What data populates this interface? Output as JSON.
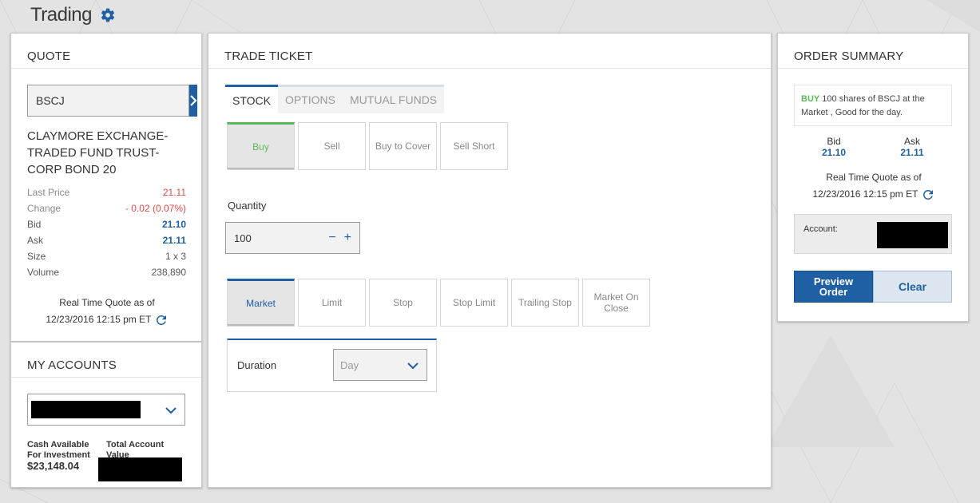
{
  "header": {
    "title": "Trading"
  },
  "quote": {
    "title": "QUOTE",
    "symbol_value": "BSCJ",
    "company": "CLAYMORE EXCHANGE-TRADED FUND TRUST-CORP BOND 20",
    "rows": [
      {
        "label": "Last Price",
        "value": "21.11"
      },
      {
        "label": "Change",
        "value": "- 0.02 (0.07%)"
      },
      {
        "label": "Bid",
        "value": "21.10"
      },
      {
        "label": "Ask",
        "value": "21.11"
      },
      {
        "label": "Size",
        "value": "1 x 3"
      },
      {
        "label": "Volume",
        "value": "238,890"
      }
    ],
    "rtq_label": "Real Time Quote as of",
    "rtq_time": "12/23/2016 12:15 pm ET"
  },
  "accounts": {
    "title": "MY ACCOUNTS",
    "cash_label_1": "Cash Available",
    "cash_label_2": "For Investment",
    "cash_value": "$23,148.04",
    "total_label_1": "Total Account",
    "total_label_2": "Value"
  },
  "ticket": {
    "title": "TRADE TICKET",
    "tabs": [
      "STOCK",
      "OPTIONS",
      "MUTUAL FUNDS"
    ],
    "actions": [
      "Buy",
      "Sell",
      "Buy to Cover",
      "Sell Short"
    ],
    "quantity_label": "Quantity",
    "quantity_value": "100",
    "minus": "−",
    "plus": "+",
    "order_types": [
      "Market",
      "Limit",
      "Stop",
      "Stop Limit",
      "Trailing Stop",
      "Market On Close"
    ],
    "duration_label": "Duration",
    "duration_value": "Day"
  },
  "summary": {
    "title": "ORDER SUMMARY",
    "buy_word": "BUY",
    "text": " 100 shares of BSCJ at the Market , Good for the day.",
    "bid_label": "Bid",
    "bid_value": "21.10",
    "ask_label": "Ask",
    "ask_value": "21.11",
    "rtq_label": "Real Time Quote as of",
    "rtq_time": "12/23/2016 12:15 pm ET",
    "account_label": "Account:",
    "preview_1": "Preview",
    "preview_2": "Order",
    "clear": "Clear"
  },
  "colors": {
    "accent": "#1f5fa3",
    "buy_green": "#5cb85c",
    "negative_red": "#e04a4a"
  }
}
